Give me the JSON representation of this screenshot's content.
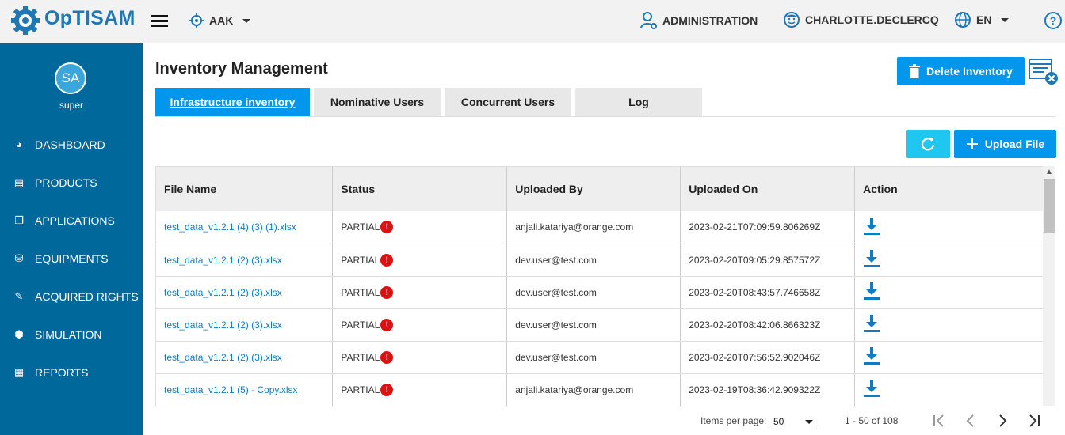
{
  "app": {
    "name": "OpTISAM",
    "tenant": "AAK"
  },
  "header": {
    "administration": "ADMINISTRATION",
    "user": "CHARLOTTE.DECLERCQ",
    "language": "EN",
    "help": "?"
  },
  "sidebar": {
    "avatar_initials": "SA",
    "username": "super",
    "items": [
      {
        "label": "DASHBOARD",
        "icon": "dashboard-icon"
      },
      {
        "label": "PRODUCTS",
        "icon": "products-icon"
      },
      {
        "label": "APPLICATIONS",
        "icon": "applications-icon"
      },
      {
        "label": "EQUIPMENTS",
        "icon": "equipments-icon"
      },
      {
        "label": "ACQUIRED RIGHTS",
        "icon": "acquired-rights-icon"
      },
      {
        "label": "SIMULATION",
        "icon": "simulation-icon"
      },
      {
        "label": "REPORTS",
        "icon": "reports-icon"
      }
    ]
  },
  "main": {
    "title": "Inventory Management",
    "delete_label": "Delete Inventory",
    "upload_label": "Upload File",
    "tabs": [
      {
        "label": "Infrastructure inventory",
        "active": true
      },
      {
        "label": "Nominative Users",
        "active": false
      },
      {
        "label": "Concurrent Users",
        "active": false
      },
      {
        "label": "Log",
        "active": false
      }
    ],
    "table": {
      "columns": [
        "File Name",
        "Status",
        "Uploaded By",
        "Uploaded On",
        "Action"
      ],
      "rows": [
        {
          "file": "test_data_v1.2.1 (4) (3) (1).xlsx",
          "status": "PARTIAL",
          "by": "anjali.katariya@orange.com",
          "on": "2023-02-21T07:09:59.806269Z"
        },
        {
          "file": "test_data_v1.2.1 (2) (3).xlsx",
          "status": "PARTIAL",
          "by": "dev.user@test.com",
          "on": "2023-02-20T09:05:29.857572Z"
        },
        {
          "file": "test_data_v1.2.1 (2) (3).xlsx",
          "status": "PARTIAL",
          "by": "dev.user@test.com",
          "on": "2023-02-20T08:43:57.746658Z"
        },
        {
          "file": "test_data_v1.2.1 (2) (3).xlsx",
          "status": "PARTIAL",
          "by": "dev.user@test.com",
          "on": "2023-02-20T08:42:06.866323Z"
        },
        {
          "file": "test_data_v1.2.1 (2) (3).xlsx",
          "status": "PARTIAL",
          "by": "dev.user@test.com",
          "on": "2023-02-20T07:56:52.902046Z"
        },
        {
          "file": "test_data_v1.2.1 (5) - Copy.xlsx",
          "status": "PARTIAL",
          "by": "anjali.katariya@orange.com",
          "on": "2023-02-19T08:36:42.909322Z"
        }
      ]
    },
    "paginator": {
      "items_per_page_label": "Items per page:",
      "items_per_page": "50",
      "range": "1 - 50 of 108"
    }
  },
  "colors": {
    "sidebar": "#01689b",
    "primary": "#0396ed",
    "refresh": "#1ec6f0",
    "link": "#0d7cc2",
    "warning": "#dd1111"
  }
}
